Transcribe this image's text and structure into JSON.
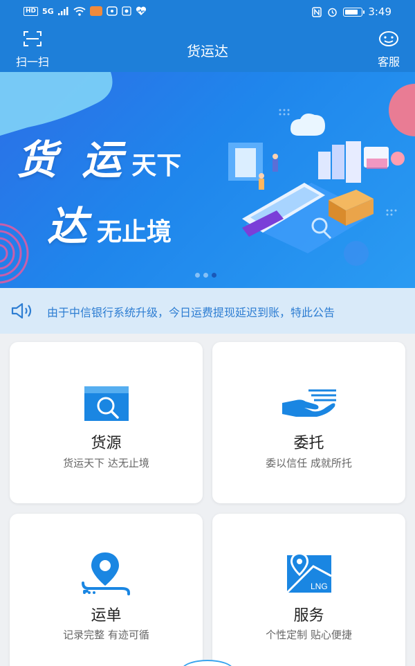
{
  "status_bar": {
    "network": "HD",
    "signal": "5G",
    "time": "3:49",
    "battery_level": 0.85
  },
  "nav": {
    "scan_label": "扫一扫",
    "title": "货运达",
    "service_label": "客服"
  },
  "banner": {
    "line1_big": "货 运",
    "line1_small": "天下",
    "line2_big": "达",
    "line2_small": "无止境",
    "page_count": 3,
    "active_page": 3
  },
  "notice": {
    "text": "由于中信银行系统升级，今日运费提现延迟到账，特此公告"
  },
  "cards": [
    {
      "title": "货源",
      "subtitle": "货运天下 达无止境",
      "icon": "cargo-search-icon"
    },
    {
      "title": "委托",
      "subtitle": "委以信任 成就所托",
      "icon": "hand-delegate-icon"
    },
    {
      "title": "运单",
      "subtitle": "记录完整 有迹可循",
      "icon": "location-pin-icon"
    },
    {
      "title": "服务",
      "subtitle": "个性定制 贴心便捷",
      "icon": "lng-map-icon",
      "badge": "LNG"
    }
  ],
  "colors": {
    "primary": "#1e7fd9",
    "notice_bg": "#d9eaf9",
    "notice_text": "#2d7dd2",
    "icon_blue": "#1a86e2"
  }
}
